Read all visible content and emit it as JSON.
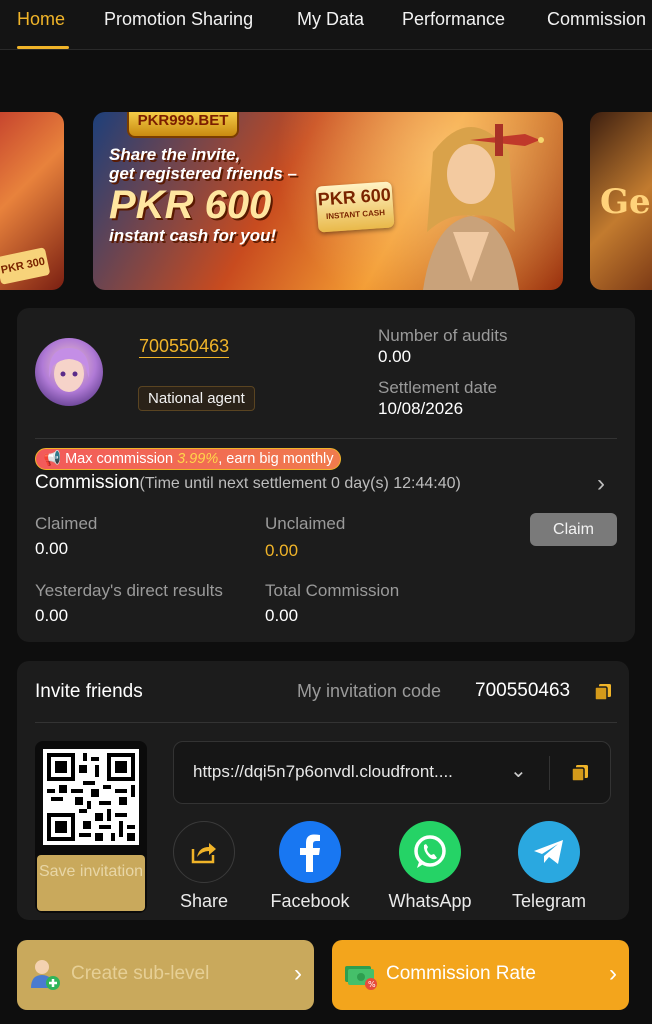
{
  "tabs": [
    {
      "label": "Home",
      "active": true
    },
    {
      "label": "Promotion Sharing",
      "active": false
    },
    {
      "label": "My Data",
      "active": false
    },
    {
      "label": "Performance",
      "active": false
    },
    {
      "label": "Commission",
      "active": false
    }
  ],
  "banner": {
    "logo": "PKR999.BET",
    "line1": "Share the invite,",
    "line1b": "get registered friends –",
    "amount": "PKR 600",
    "line3": "instant cash for you!",
    "card_amount": "PKR 600",
    "card_sub": "INSTANT CASH",
    "left_tag": "PKR 300",
    "right_text": "Ge"
  },
  "agent": {
    "id": "700550463",
    "badge": "National agent",
    "audits_label": "Number of audits",
    "audits_value": "0.00",
    "settlement_label": "Settlement date",
    "settlement_value": "10/08/2026"
  },
  "commission": {
    "pill_prefix": "Max commission ",
    "pill_rate": "3.99%",
    "pill_suffix": ", earn big monthly",
    "title": "Commission",
    "timer_text": "(Time until next settlement  0 day(s) 12:44:40)",
    "claimed_label": "Claimed",
    "claimed_value": "0.00",
    "unclaimed_label": "Unclaimed",
    "unclaimed_value": "0.00",
    "claim_button": "Claim",
    "yesterday_label": "Yesterday's direct results",
    "yesterday_value": "0.00",
    "total_label": "Total Commission",
    "total_value": "0.00"
  },
  "invite": {
    "title": "Invite friends",
    "code_label": "My invitation code",
    "code": "700550463",
    "save_button": "Save invitation",
    "link": "https://dqi5n7p6onvdl.cloudfront....",
    "share": [
      {
        "label": "Share",
        "icon": "share-icon"
      },
      {
        "label": "Facebook",
        "icon": "facebook-icon"
      },
      {
        "label": "WhatsApp",
        "icon": "whatsapp-icon"
      },
      {
        "label": "Telegram",
        "icon": "telegram-icon"
      }
    ]
  },
  "actions": {
    "create_sub": "Create sub-level",
    "commission_rate": "Commission Rate"
  },
  "colors": {
    "accent": "#f0b429",
    "background": "#0e0e0e",
    "card": "#1c1c1c",
    "facebook": "#1877f2",
    "whatsapp": "#25d366",
    "telegram": "#2aa8e0",
    "rate_button": "#f3a51c",
    "sub_button": "#c9a95c"
  }
}
